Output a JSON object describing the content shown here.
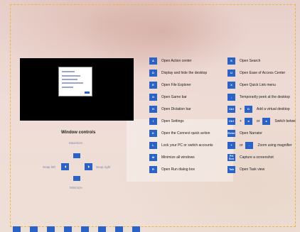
{
  "colors": {
    "key_blue": "#2b62c6",
    "label_gray": "#7d89b2",
    "thumb_bg": "#000000"
  },
  "window_controls": {
    "title": "Window controls",
    "maximize": "Maximize",
    "snap_left": "Snap left",
    "snap_right": "Snap right",
    "minimize": "Minimize"
  },
  "shortcuts_left": [
    {
      "key": "A",
      "desc": "Open Action center"
    },
    {
      "key": "D",
      "desc": "Display and hide the desktop"
    },
    {
      "key": "E",
      "desc": "Open File Explorer"
    },
    {
      "key": "G",
      "desc": "Open Game bar"
    },
    {
      "key": "H",
      "desc": "Open Dictation bar"
    },
    {
      "key": "I",
      "desc": "Open Settings"
    },
    {
      "key": "K",
      "desc": "Open the Connect quick action"
    },
    {
      "key": "L",
      "desc": "Lock your PC or switch accounts"
    },
    {
      "key": "M",
      "desc": "Minimize all windows"
    },
    {
      "key": "R",
      "desc": "Open Run dialog box"
    }
  ],
  "shortcuts_right": {
    "search": {
      "key": "S",
      "desc": "Open Search"
    },
    "ease": {
      "key": "U",
      "desc": "Open Ease of Access Center"
    },
    "quicklink": {
      "key": "X",
      "desc": "Open Quick Link menu"
    },
    "peek": {
      "key": ",",
      "desc": "Temporarily peek at the desktop"
    },
    "vdesk": {
      "key1": "Ctrl",
      "plus": "+",
      "key2": "D",
      "desc": "Add a virtual desktop"
    },
    "switch": {
      "key1": "Ctrl",
      "plus": "+",
      "key2": "◂",
      "or": "or",
      "key3": "▸",
      "desc": "Switch betwe"
    },
    "narrator": {
      "key": "Enter",
      "desc": "Open Narrator"
    },
    "magnifier": {
      "key1": "+",
      "or": "or",
      "key2": "-",
      "desc": "Zoom using magnifier"
    },
    "screenshot": {
      "key": "Prt Scn",
      "desc": "Capture a screenshot"
    },
    "taskview": {
      "key": "Tab",
      "desc": "Open Task view"
    }
  }
}
